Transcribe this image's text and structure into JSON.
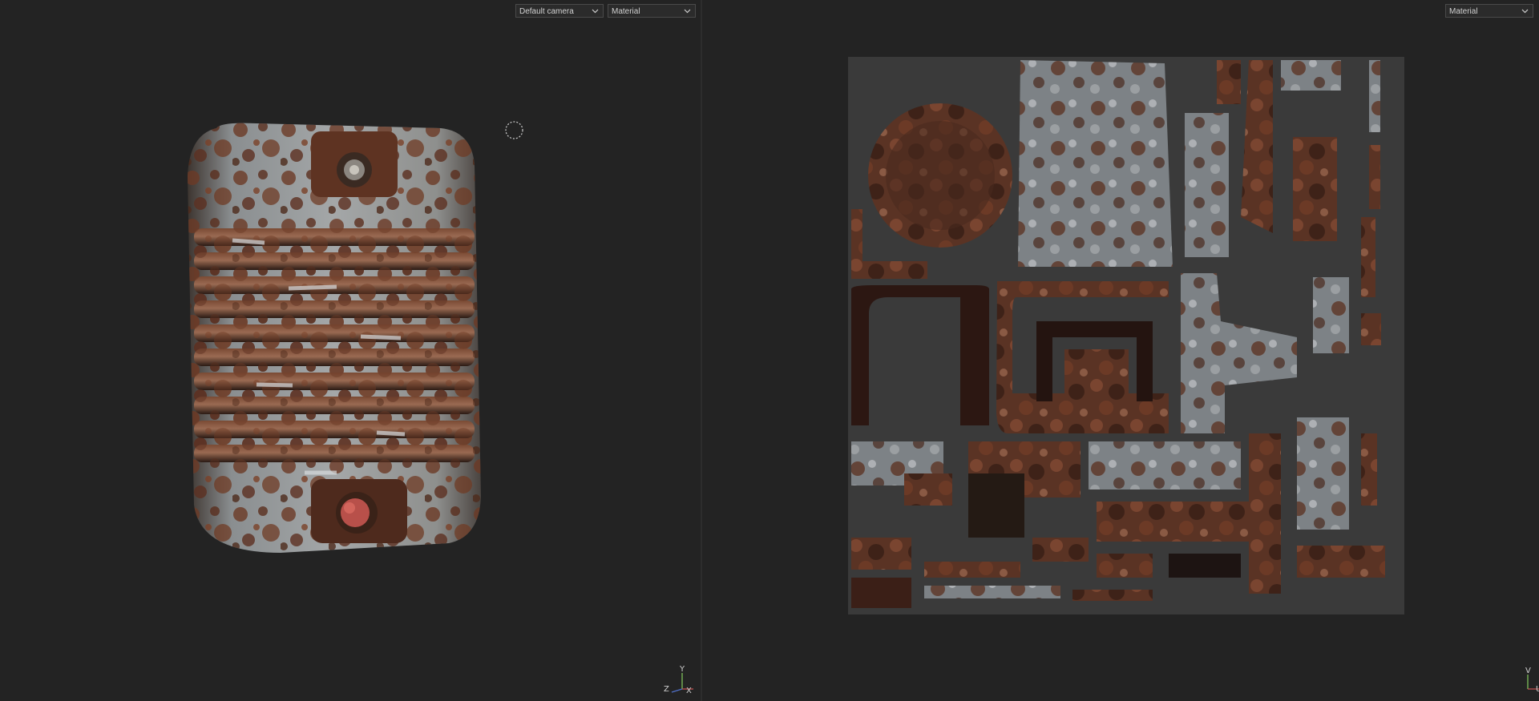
{
  "viewport3d": {
    "camera_select": {
      "value": "Default camera"
    },
    "material_select": {
      "value": "Material"
    },
    "axis": {
      "y": "Y",
      "z": "Z",
      "x": "X"
    }
  },
  "viewport2d": {
    "material_select": {
      "value": "Material"
    },
    "axis": {
      "v": "V",
      "u": "U"
    }
  },
  "colors": {
    "background": "#232323",
    "rust": "#6b3a26",
    "metal": "#9aa0a4",
    "uv_background": "#3a3a3a"
  },
  "icons": [
    "chevron-down-icon",
    "brush-cursor-icon",
    "axis-gizmo-icon"
  ]
}
